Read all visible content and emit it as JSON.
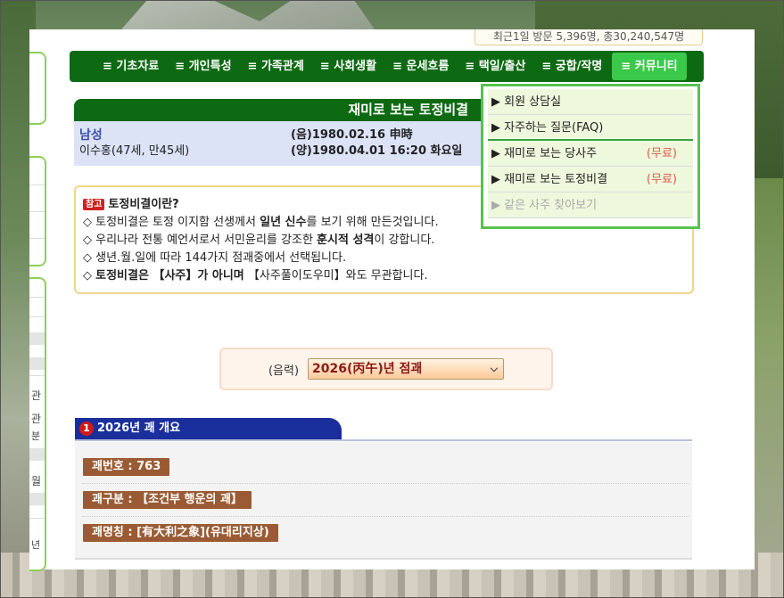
{
  "visitor_stats": "최근1일 방문 5,396명, 총30,240,547명",
  "nav": {
    "items": [
      "≡ 기초자료",
      "≡ 개인특성",
      "≡ 가족관계",
      "≡ 사회생활",
      "≡ 운세흐름",
      "≡ 택일/출산",
      "≡ 궁합/작명",
      "≡ 커뮤니티"
    ]
  },
  "title": "재미로 보는 토정비결",
  "profile": {
    "gender": "남성",
    "lunar": "(음)1980.02.16 申時",
    "name_age": "이수홍(47세, 만45세)",
    "solar": "(양)1980.04.01 16:20 화요일"
  },
  "note": {
    "badge": "참고",
    "heading": "토정비결이란?",
    "line1_a": "◇ 토정비결은 토정 이지함 선생께서 ",
    "line1_b": "일년 신수",
    "line1_c": "를 보기 위해 만든것입니다.",
    "line2_a": "◇ 우리나라 전통 예언서로서 서민윤리를 강조한 ",
    "line2_b": "훈시적 성격",
    "line2_c": "이 강합니다.",
    "line3": "◇ 생년.월.일에 따라 144가지 점괘중에서 선택됩니다.",
    "line4_a": "◇ ",
    "line4_b": "토정비결은 【사주】가 아니며",
    "line4_c": " 【사주풀이도우미】와도 무관합니다."
  },
  "dropdown": {
    "items": [
      {
        "label": "▶ 회원 상담실",
        "tag": ""
      },
      {
        "label": "▶ 자주하는 질문(FAQ)",
        "tag": ""
      },
      {
        "label": "▶ 재미로 보는 당사주",
        "tag": "(무료)"
      },
      {
        "label": "▶ 재미로 보는 토정비결",
        "tag": "(무료)"
      },
      {
        "label": "▶ 같은 사주 찾아보기",
        "tag": ""
      }
    ]
  },
  "selector": {
    "label": "(음력)",
    "value": "2026(丙午)년 점괘"
  },
  "section": {
    "number": "1",
    "title": "2026년 괘 개요",
    "gwae_number": "괘번호 : 763",
    "gwae_category": "괘구분 : 【조건부 행운의 괘】",
    "gwae_name": "괘명칭 : [有大利之象](유대리지상)"
  },
  "side_fragments": [
    "관",
    "관",
    "분",
    "월",
    "년"
  ]
}
